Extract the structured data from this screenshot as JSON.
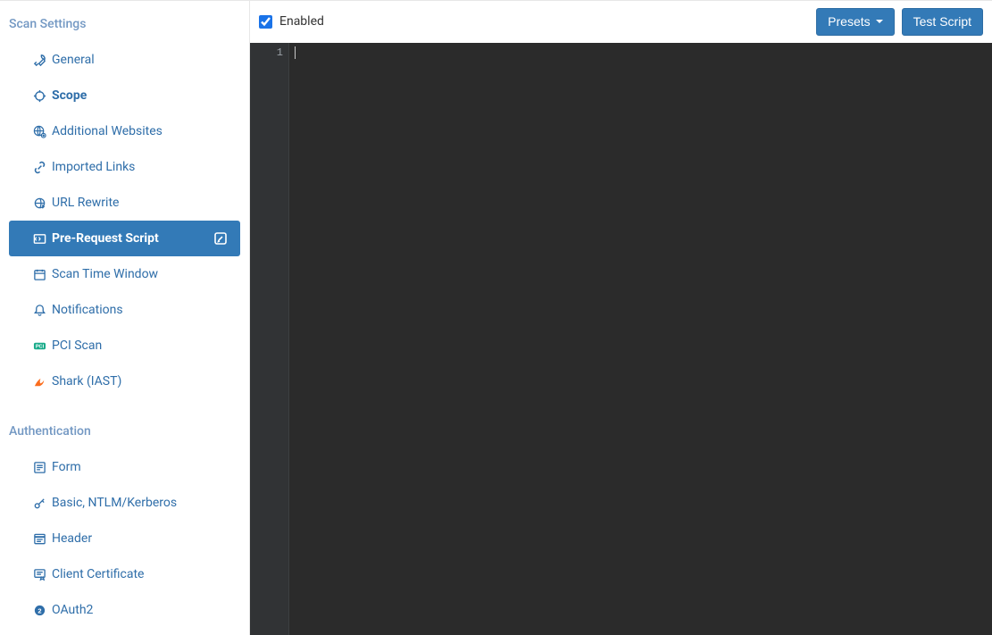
{
  "sidebar": {
    "section1_title": "Scan Settings",
    "section2_title": "Authentication",
    "items1": [
      {
        "icon": "wrench",
        "label": "General",
        "bold": false,
        "active": false
      },
      {
        "icon": "target",
        "label": "Scope",
        "bold": true,
        "active": false
      },
      {
        "icon": "globe-plus",
        "label": "Additional Websites",
        "bold": false,
        "active": false
      },
      {
        "icon": "link",
        "label": "Imported Links",
        "bold": false,
        "active": false
      },
      {
        "icon": "rewrite",
        "label": "URL Rewrite",
        "bold": false,
        "active": false
      },
      {
        "icon": "script",
        "label": "Pre-Request Script",
        "bold": true,
        "active": true,
        "trail": "edit"
      },
      {
        "icon": "calendar",
        "label": "Scan Time Window",
        "bold": false,
        "active": false
      },
      {
        "icon": "bell",
        "label": "Notifications",
        "bold": false,
        "active": false
      },
      {
        "icon": "pci",
        "label": "PCI Scan",
        "bold": false,
        "active": false
      },
      {
        "icon": "shark",
        "label": "Shark (IAST)",
        "bold": false,
        "active": false
      }
    ],
    "items2": [
      {
        "icon": "form",
        "label": "Form",
        "bold": false,
        "active": false
      },
      {
        "icon": "key",
        "label": "Basic, NTLM/Kerberos",
        "bold": false,
        "active": false
      },
      {
        "icon": "header",
        "label": "Header",
        "bold": false,
        "active": false
      },
      {
        "icon": "cert",
        "label": "Client Certificate",
        "bold": false,
        "active": false
      },
      {
        "icon": "oauth",
        "label": "OAuth2",
        "bold": false,
        "active": false
      }
    ]
  },
  "toolbar": {
    "enabled_checked": true,
    "enabled_label": "Enabled",
    "presets_label": "Presets",
    "test_label": "Test Script"
  },
  "editor": {
    "line_number": "1",
    "content": ""
  }
}
